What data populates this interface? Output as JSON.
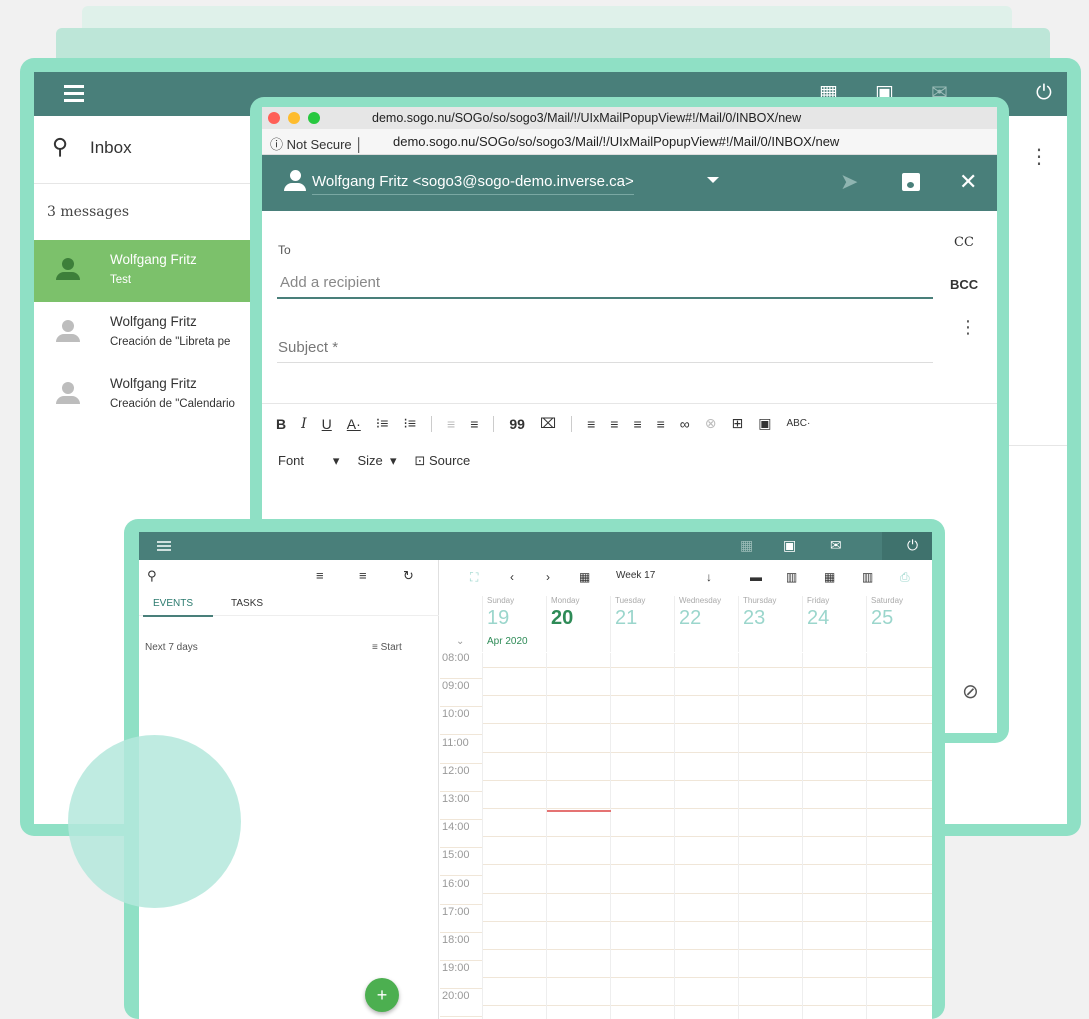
{
  "mail": {
    "search_label": "Inbox",
    "message_count": "3 messages",
    "messages": [
      {
        "sender": "Wolfgang Fritz",
        "subject": "Test"
      },
      {
        "sender": "Wolfgang Fritz",
        "subject": "Creación de \"Libreta pe"
      },
      {
        "sender": "Wolfgang Fritz",
        "subject": "Creación de \"Calendario"
      }
    ]
  },
  "browser": {
    "title": "demo.sogo.nu/SOGo/so/sogo3/Mail/!/UIxMailPopupView#!/Mail/0/INBOX/new",
    "security": "Not Secure",
    "url": "demo.sogo.nu/SOGo/so/sogo3/Mail/!/UIxMailPopupView#!/Mail/0/INBOX/new"
  },
  "compose": {
    "from": "Wolfgang Fritz <sogo3@sogo-demo.inverse.ca>",
    "to_label": "To",
    "cc_label": "CC",
    "bcc_label": "BCC",
    "recipient_placeholder": "Add a recipient",
    "subject_placeholder": "Subject *",
    "toolbar": [
      "B",
      "I",
      "U",
      "A·",
      "⁝≡",
      "⁝≡",
      "≡",
      "≡",
      "99",
      "⌧",
      "≡",
      "≡",
      "≡",
      "≡",
      "∞",
      "⊗",
      "⊞",
      "▣",
      "ABC·"
    ],
    "font_label": "Font",
    "size_label": "Size",
    "source_label": "Source"
  },
  "calendar": {
    "tab_events": "EVENTS",
    "tab_tasks": "TASKS",
    "filter_label": "Next 7 days",
    "sort_label": "Start",
    "week_label": "Week 17",
    "month_label": "Apr 2020",
    "days": [
      {
        "name": "Sunday",
        "num": "19"
      },
      {
        "name": "Monday",
        "num": "20"
      },
      {
        "name": "Tuesday",
        "num": "21"
      },
      {
        "name": "Wednesday",
        "num": "22"
      },
      {
        "name": "Thursday",
        "num": "23"
      },
      {
        "name": "Friday",
        "num": "24"
      },
      {
        "name": "Saturday",
        "num": "25"
      }
    ],
    "hours": [
      "08:00",
      "09:00",
      "10:00",
      "11:00",
      "12:00",
      "13:00",
      "14:00",
      "15:00",
      "16:00",
      "17:00",
      "18:00",
      "19:00",
      "20:00"
    ],
    "fab_label": "+"
  },
  "colors": {
    "primary": "#497f7a",
    "accent_green": "#7cc16b",
    "frame": "#8fe0c5"
  }
}
